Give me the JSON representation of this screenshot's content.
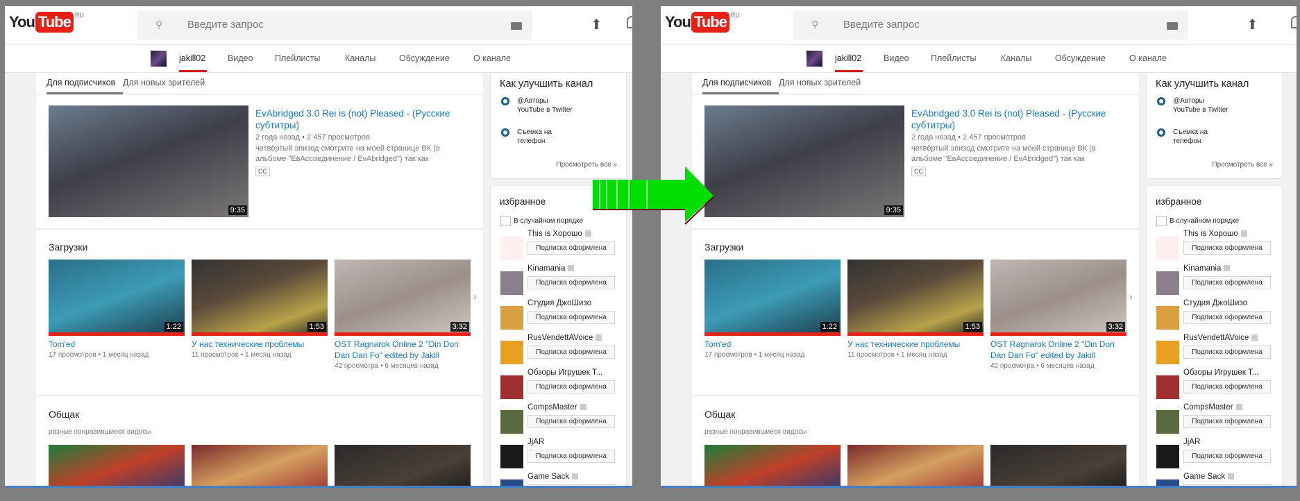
{
  "header": {
    "logo_you": "You",
    "logo_tube": "Tube",
    "logo_region": "RU",
    "search_placeholder": "Введите запрос"
  },
  "nav": {
    "channel": "jakill02",
    "items": [
      "Видео",
      "Плейлисты",
      "Каналы",
      "Обсуждение",
      "О канале"
    ]
  },
  "tabs": [
    "Для подписчиков",
    "Для новых зрителей"
  ],
  "featured": {
    "title_line1": "EvAbridged 3.0 Rei is (not) Pleased - (Русские",
    "title_line2": "субтитры)",
    "meta": "2 года назад • 2 457 просмотров",
    "desc_line1": "четвёртый эпизод смотрите на моей странице ВК (в",
    "desc_line2": "альбоме \"ЕвАссоединение / EvAbridged\") так как",
    "cc": "CC",
    "duration": "9:35"
  },
  "uploads": {
    "title": "Загрузки",
    "videos": [
      {
        "title": "Tom'ed",
        "title2": "",
        "meta": "17 просмотров • 1 месяц назад",
        "duration": "1:22"
      },
      {
        "title": "У нас технические проблемы",
        "title2": "",
        "meta": "11 просмотров • 1 месяц назад",
        "duration": "1:53"
      },
      {
        "title": "OST Ragnarok Online 2 \"Din Don",
        "title2": "Dan Dan Fo\" edited by Jakill",
        "meta": "42 просмотра • 6 месяцев назад",
        "duration": "3:32"
      }
    ]
  },
  "obshak": {
    "title": "Общак",
    "subtitle": "разные понравившиеся видосы"
  },
  "improve": {
    "title": "Как улучшить канал",
    "items": [
      "@Авторы YouTube в Twitter",
      "Съемка на телефон"
    ],
    "more": "Просмотреть все  »"
  },
  "favorites": {
    "title": "избранное",
    "shuffle": "В случайном порядке",
    "subscribed_label": "Подписка оформлена",
    "channels": [
      "This is Хорошо",
      "Kinamania",
      "Студия ДжоШизо",
      "RusVendettAVoice",
      "Обзоры Игрушек Т...",
      "CompsMaster",
      "JjAR",
      "Game Sack"
    ]
  },
  "colors": {
    "accent": "#e62117",
    "link": "#167ac6",
    "arrow": "#00dd00"
  }
}
